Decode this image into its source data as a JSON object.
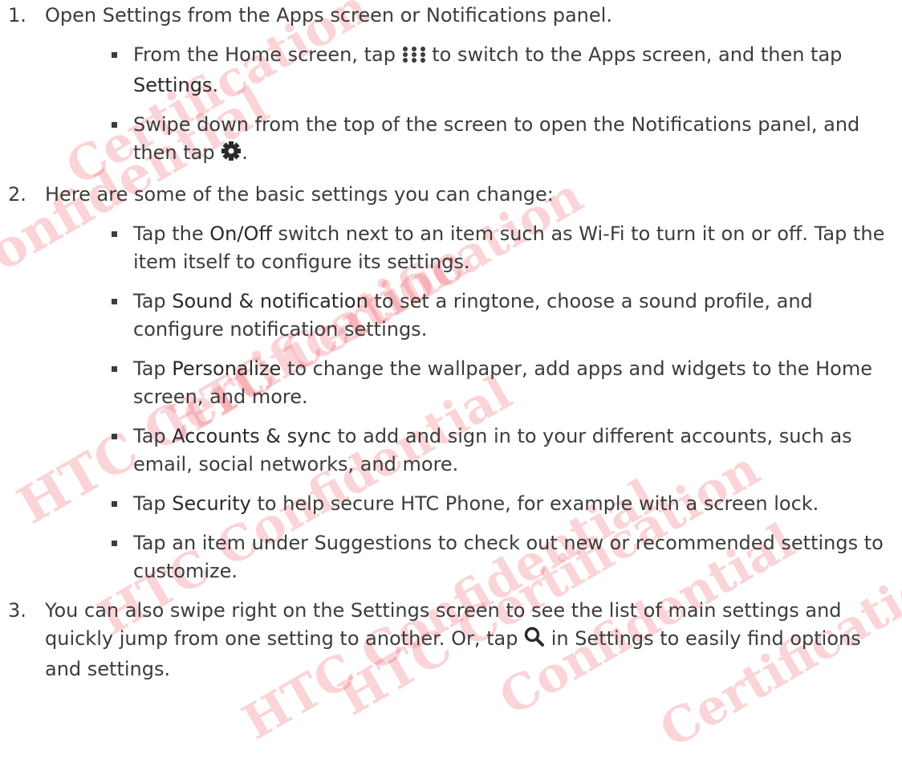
{
  "steps": [
    {
      "num": "1.",
      "text": "Open Settings from the Apps screen or Notifications panel.",
      "bullets": [
        {
          "t1": "From the Home screen, tap ",
          "t2": " to switch to the Apps screen, and then tap ",
          "ui": "Settings",
          "t3": "."
        },
        {
          "t1": "Swipe down from the top of the screen to open the Notifications panel, and then tap ",
          "t2": "."
        }
      ]
    },
    {
      "num": "2.",
      "text": "Here are some of the basic settings you can change:",
      "bullets": [
        {
          "t1": "Tap the ",
          "ui": "On/Off",
          "t2": "  switch next to an item such as Wi-Fi to turn it on or off. Tap the item itself to configure its settings."
        },
        {
          "t1": "Tap ",
          "ui": "Sound & notification",
          "t2": " to set a ringtone, choose a sound profile, and configure notification settings."
        },
        {
          "t1": "Tap ",
          "ui": "Personalize",
          "t2": " to change the wallpaper, add apps and widgets to the Home screen, and more."
        },
        {
          "t1": "Tap ",
          "ui": "Accounts & sync",
          "t2": " to add and sign in to your different accounts, such as email, social networks, and more."
        },
        {
          "t1": "Tap ",
          "ui": "Security",
          "t2": " to help secure HTC Phone, for example with a screen lock."
        },
        {
          "t1": "Tap an item under Suggestions to check out new or recommended settings to customize."
        }
      ]
    },
    {
      "num": "3.",
      "t1": "You can also swipe right on the Settings screen to see the list of main settings and quickly jump from one setting to another. Or, tap ",
      "t2": " in Settings to easily find options and settings."
    }
  ],
  "icons": {
    "apps": "apps-grid-icon",
    "settings": "gear-icon",
    "search": "search-icon"
  },
  "watermark": {
    "lines": [
      "Confidential",
      "HTC Certification",
      "HTC Confidential",
      "HTC Certification",
      "HTC Confidential",
      "HTC Certification",
      "Confidential",
      "Certification",
      "Certification"
    ],
    "color": "#e83c4b"
  }
}
